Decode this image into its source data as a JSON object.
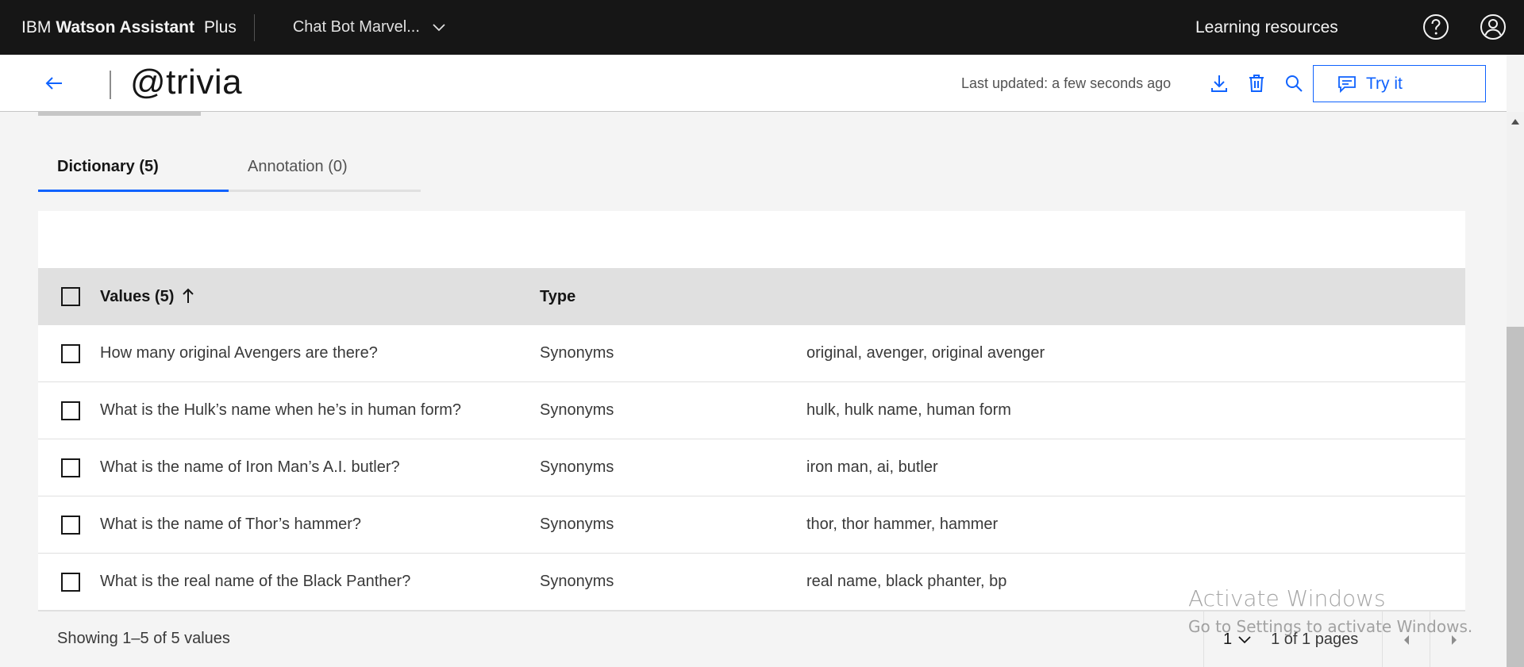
{
  "header": {
    "brand_company": "IBM",
    "brand_product": "Watson Assistant",
    "brand_plan": "Plus",
    "assistant_name": "Chat Bot Marvel...",
    "learning_resources": "Learning resources"
  },
  "entity": {
    "title": "@trivia",
    "last_updated": "Last updated: a few seconds ago",
    "try_it_label": "Try it"
  },
  "tabs": [
    {
      "label": "Dictionary (5)",
      "active": true
    },
    {
      "label": "Annotation (0)",
      "active": false
    }
  ],
  "table": {
    "headers": {
      "values": "Values (5)",
      "type": "Type"
    },
    "rows": [
      {
        "value": "How many original Avengers are there?",
        "type": "Synonyms",
        "synonyms": "original, avenger, original avenger"
      },
      {
        "value": "What is the Hulk’s name when he’s in human form?",
        "type": "Synonyms",
        "synonyms": "hulk, hulk name, human form"
      },
      {
        "value": "What is the name of Iron Man’s A.I. butler?",
        "type": "Synonyms",
        "synonyms": "iron man, ai, butler"
      },
      {
        "value": "What is the name of Thor’s hammer?",
        "type": "Synonyms",
        "synonyms": "thor, thor hammer, hammer"
      },
      {
        "value": "What is the real name of the Black Panther?",
        "type": "Synonyms",
        "synonyms": "real name, black phanter, bp"
      }
    ],
    "footer": {
      "showing": "Showing 1–5 of 5 values",
      "page": "1",
      "pages": "1 of 1 pages"
    }
  },
  "watermark": {
    "line1": "Activate Windows",
    "line2": "Go to Settings to activate Windows."
  },
  "colors": {
    "accent": "#0f62fe",
    "header_bg": "#161616",
    "table_header_bg": "#e0e0e0"
  },
  "icons": [
    "chevron-down-icon",
    "help-icon",
    "user-icon",
    "back-arrow-icon",
    "download-icon",
    "delete-icon",
    "search-icon",
    "chat-icon",
    "sort-ascending-icon",
    "caret-left-icon",
    "caret-right-icon"
  ]
}
